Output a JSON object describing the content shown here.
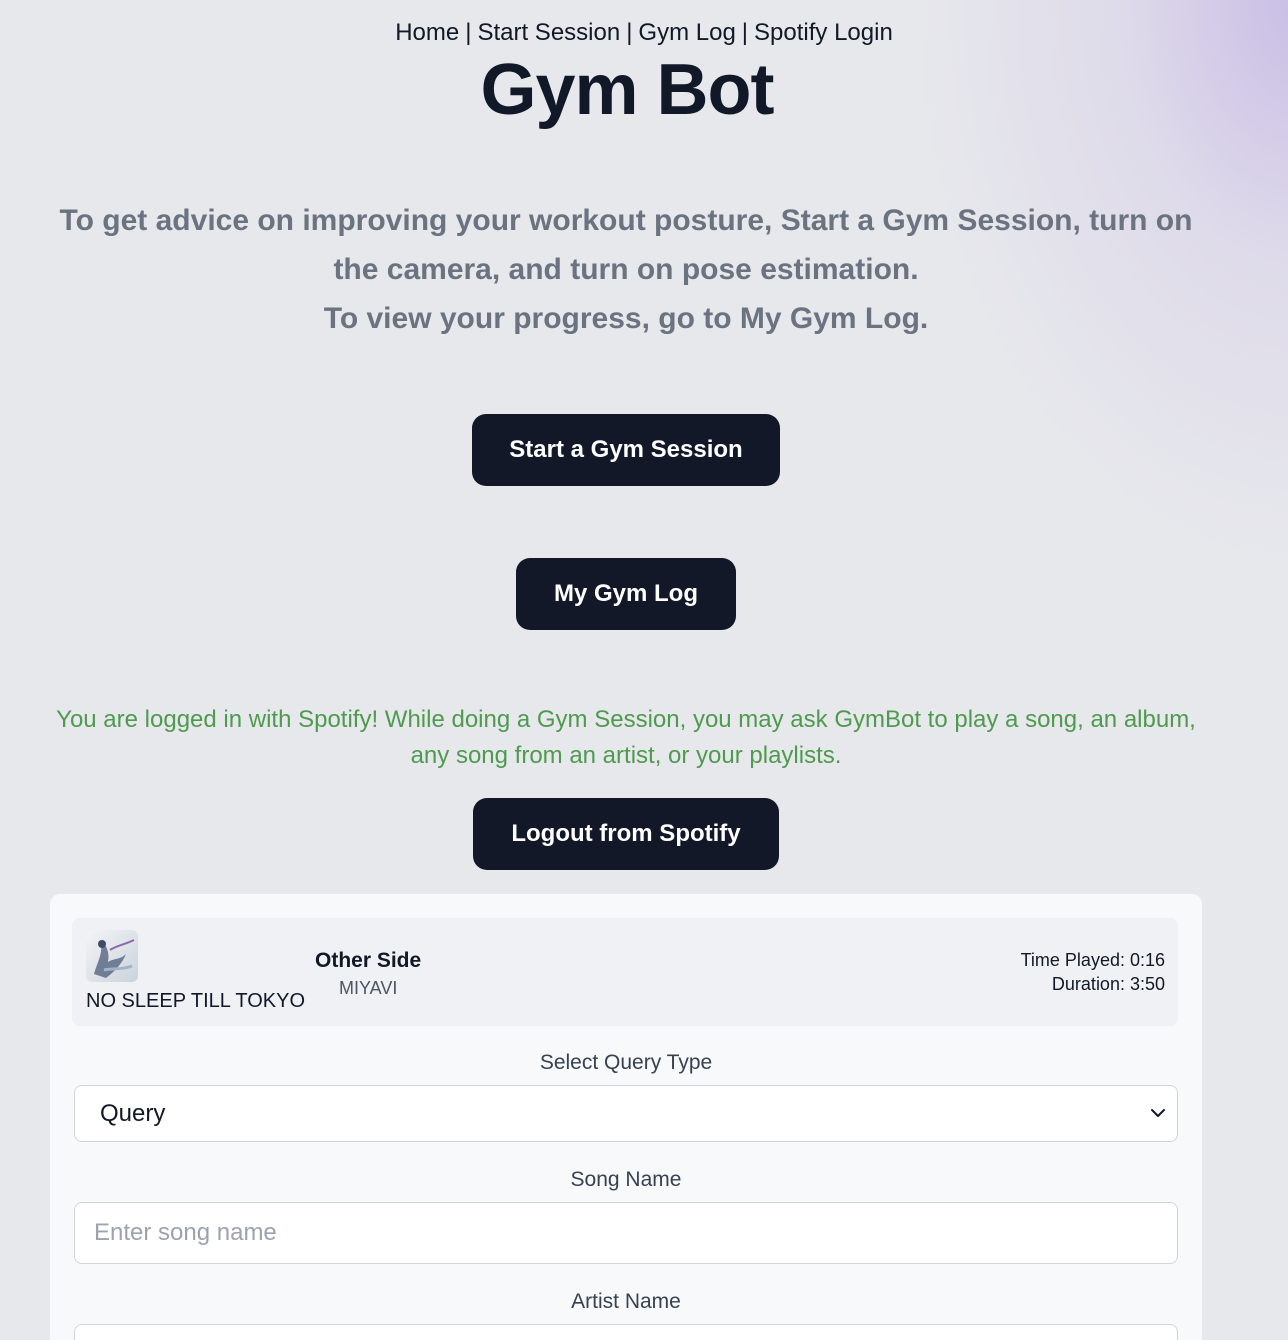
{
  "nav": {
    "items": [
      "Home",
      "Start Session",
      "Gym Log",
      "Spotify Login"
    ],
    "separator": "|"
  },
  "title": "Gym Bot",
  "intro": {
    "line1": "To get advice on improving your workout posture, Start a Gym Session, turn on the camera, and turn on pose estimation.",
    "line2": "To view your progress, go to My Gym Log."
  },
  "buttons": {
    "start_session": "Start a Gym Session",
    "gym_log": "My Gym Log",
    "logout": "Logout from Spotify"
  },
  "spotify_message": "You are logged in with Spotify! While doing a Gym Session, you may ask GymBot to play a song, an album, any song from an artist, or your playlists.",
  "now_playing": {
    "album": "NO SLEEP TILL TOKYO",
    "song": "Other Side",
    "artist": "MIYAVI",
    "time_played": "Time Played: 0:16",
    "duration": "Duration: 3:50"
  },
  "form": {
    "query_type_label": "Select Query Type",
    "query_type_value": "Query",
    "song_label": "Song Name",
    "song_placeholder": "Enter song name",
    "artist_label": "Artist Name",
    "artist_placeholder": ""
  },
  "colors": {
    "background": "#e7e8ec",
    "button": "#121827",
    "spotify_text": "#4e9a4e",
    "intro_text": "#6b7280"
  }
}
